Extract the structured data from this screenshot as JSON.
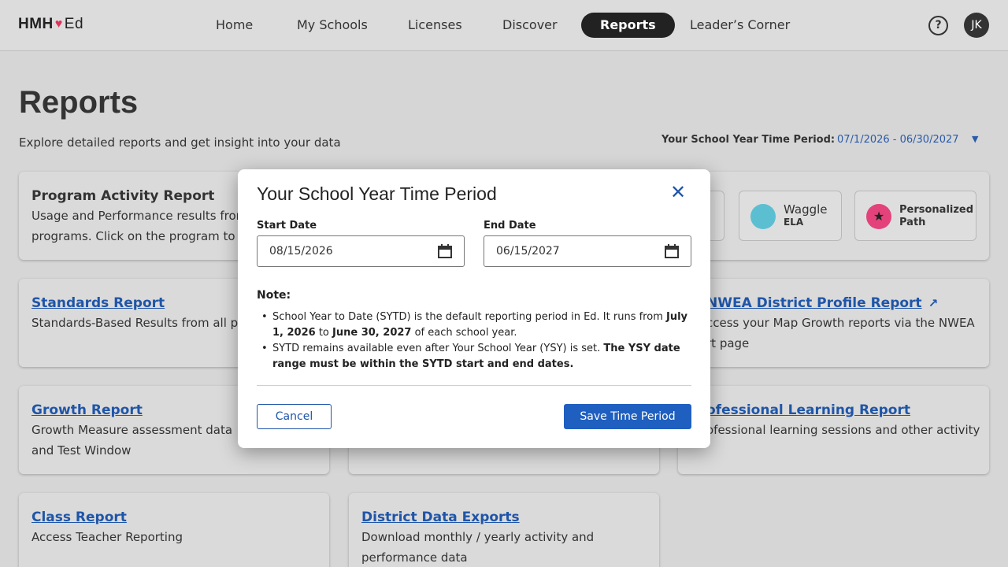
{
  "app": {
    "logo_main": "HMH",
    "logo_ed": "Ed"
  },
  "nav": {
    "items": [
      {
        "label": "Home"
      },
      {
        "label": "My Schools"
      },
      {
        "label": "Licenses"
      },
      {
        "label": "Discover"
      },
      {
        "label": "Reports"
      },
      {
        "label": "Leader’s Corner"
      }
    ],
    "help_label": "?",
    "avatar_initials": "JK"
  },
  "header": {
    "title": "Reports",
    "subtitle": "Explore detailed reports and get insight into your data",
    "period_label": "Your School Year Time Period:",
    "period_value": "07/1/2026 - 06/30/2027"
  },
  "cards": {
    "program_activity": {
      "title": "Program Activity Report",
      "desc_1": "Usage and Performance results from",
      "desc_2": "programs. Click on the program to"
    },
    "waggle": {
      "name": "Waggle",
      "sub": "ELA"
    },
    "personalized_path": {
      "line1": "Personalized",
      "line2": "Path"
    },
    "standards": {
      "title": "Standards Report",
      "desc": "Standards-Based Results from all p"
    },
    "nwea": {
      "title": "NWEA District Profile Report",
      "desc_1": "ccess your Map Growth reports via the NWEA",
      "desc_2": "rt page"
    },
    "growth": {
      "title": "Growth Report",
      "desc_1": "Growth Measure assessment data",
      "desc_2": "and Test Window"
    },
    "professional": {
      "title": "ofessional Learning Report",
      "desc": "ofessional learning sessions and other activity"
    },
    "class": {
      "title": "Class Report",
      "desc": "Access Teacher Reporting"
    },
    "district_exports": {
      "title": "District Data Exports",
      "desc_1": "Download monthly / yearly activity and",
      "desc_2": "performance data"
    }
  },
  "modal": {
    "title": "Your School Year Time Period",
    "start_label": "Start Date",
    "start_value": "08/15/2026",
    "end_label": "End Date",
    "end_value": "06/15/2027",
    "note_title": "Note:",
    "note_1a": "School Year to Date (SYTD) is the default reporting period in Ed. It runs from ",
    "note_1b": "July 1, 2026",
    "note_1c": " to ",
    "note_1d": "June 30, 2027",
    "note_1e": " of each school year.",
    "note_2a": "SYTD remains available even after Your School Year (YSY) is set. ",
    "note_2b": "The YSY date range must be within the SYTD start and end dates.",
    "cancel_label": "Cancel",
    "save_label": "Save Time Period"
  },
  "colors": {
    "accent": "#1f5fc0",
    "link": "#1f55a8",
    "logo_heart": "#e0335b",
    "nav_active_bg": "#222222"
  }
}
